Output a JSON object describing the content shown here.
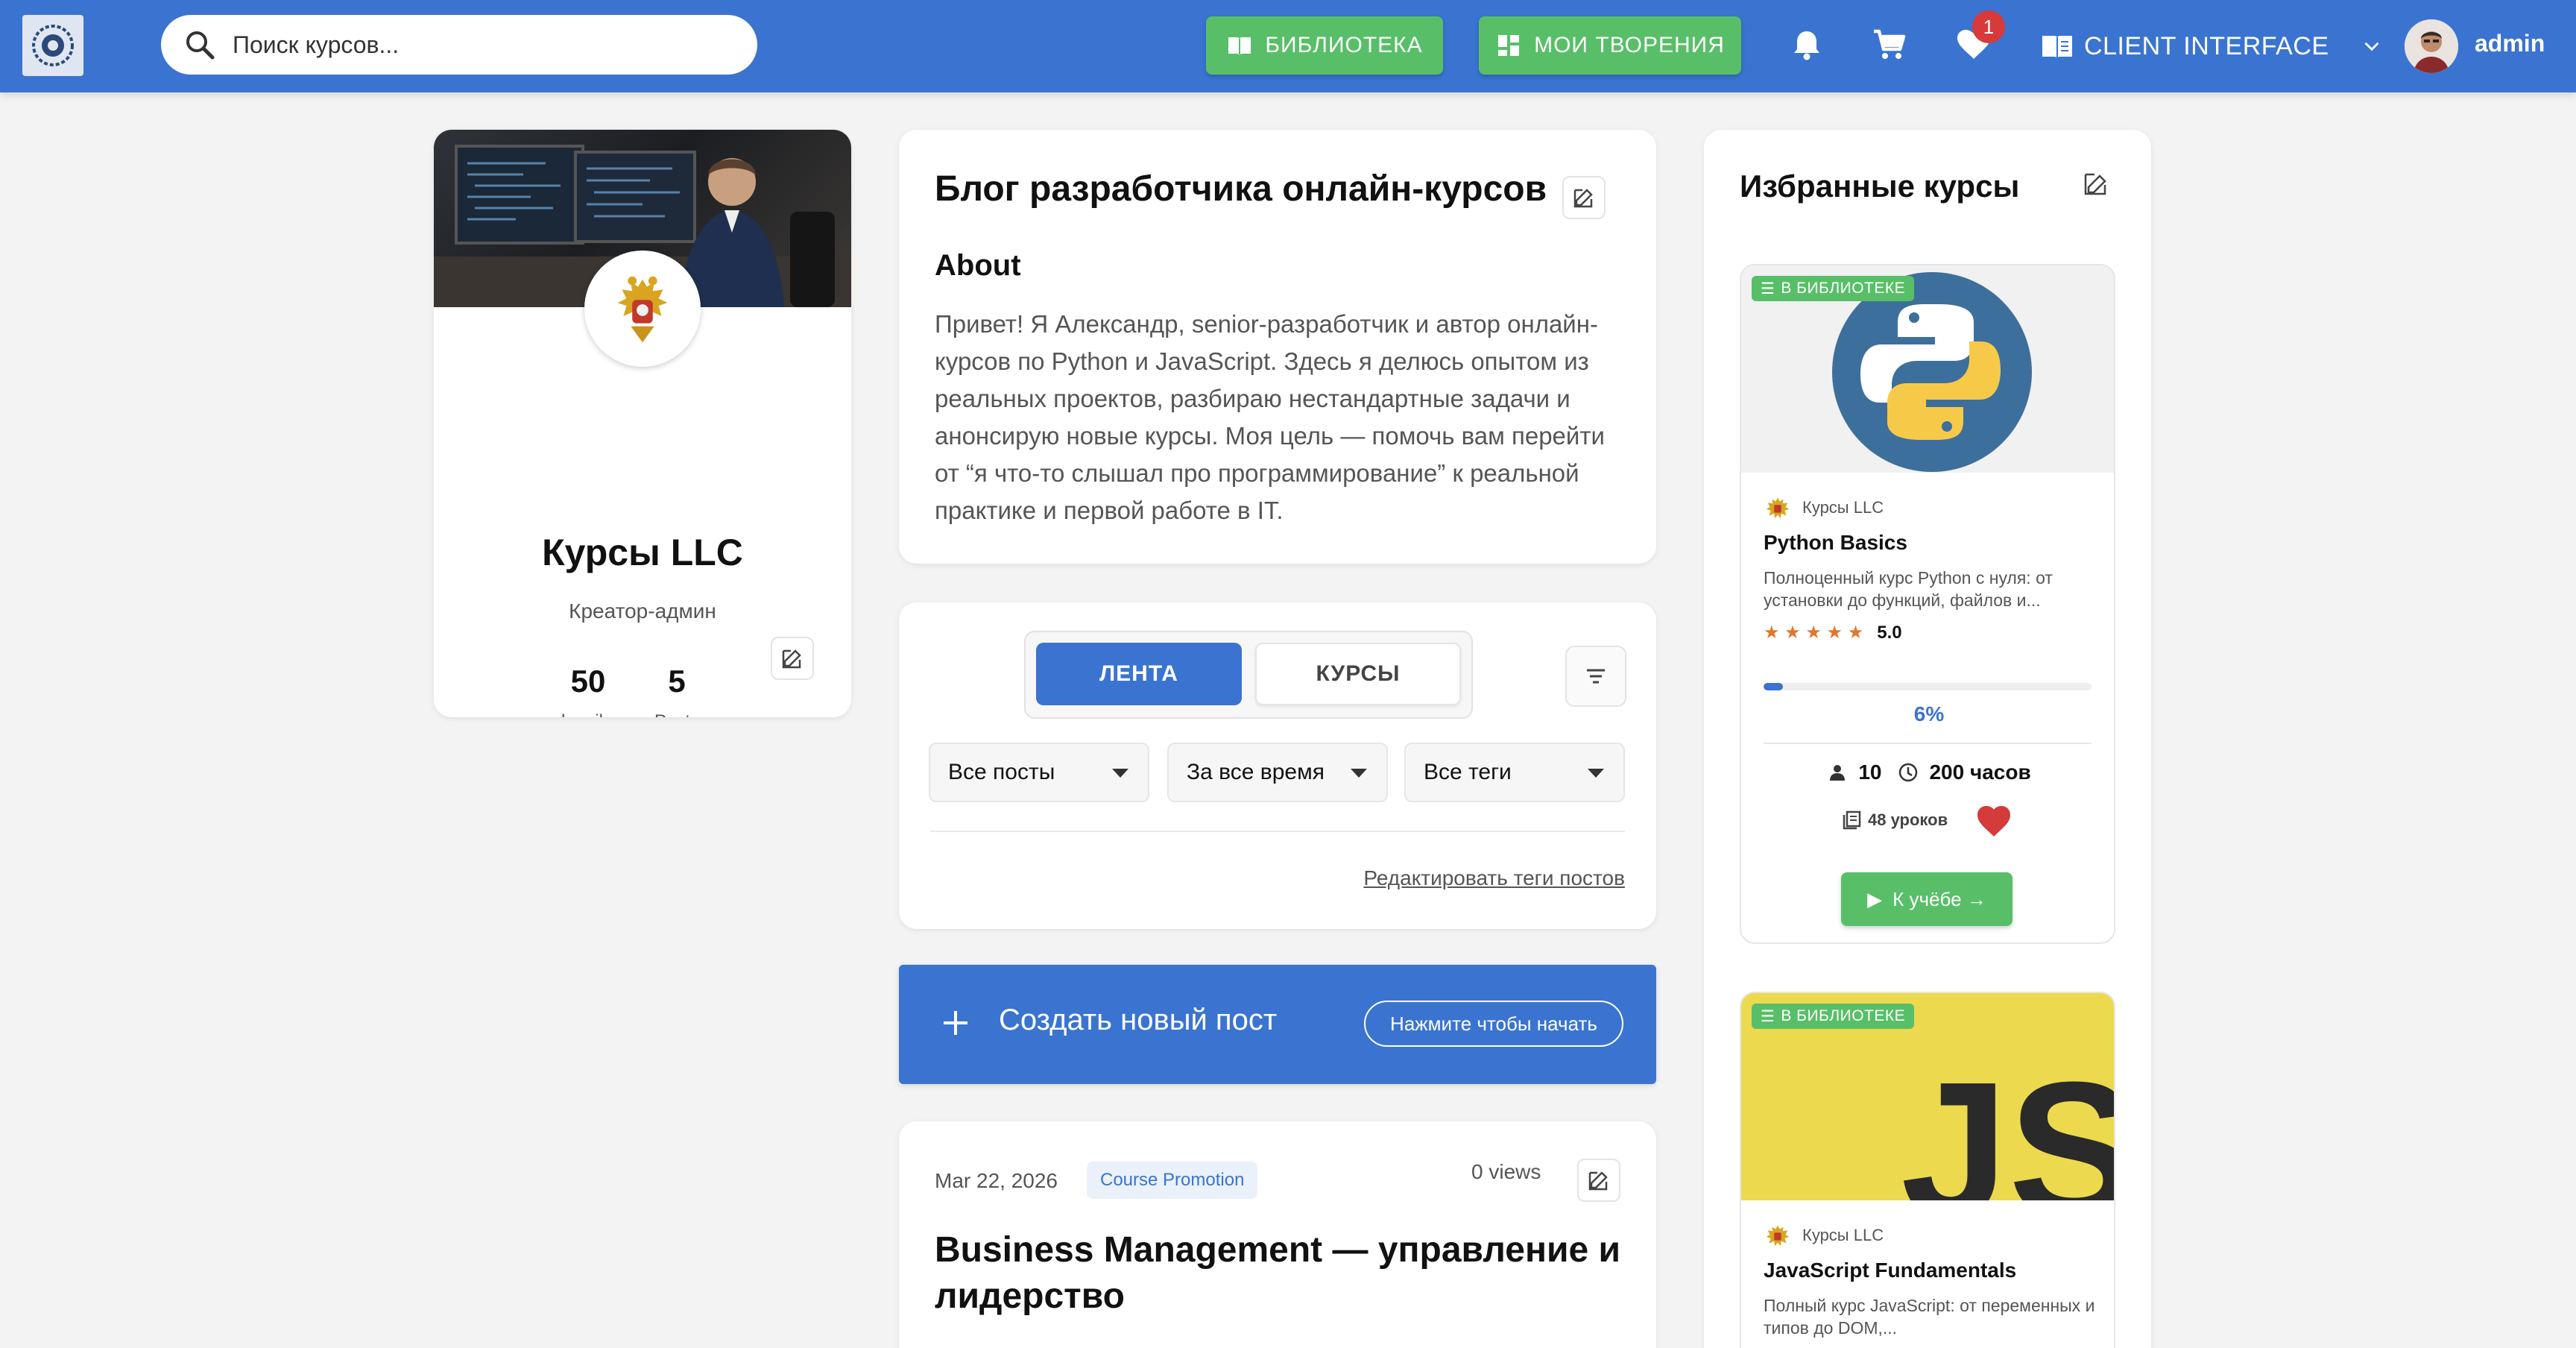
{
  "header": {
    "search_placeholder": "Поиск курсов...",
    "library_label": "БИБЛИОТЕКА",
    "creations_label": "МОИ ТВОРЕНИЯ",
    "favorites_badge": "1",
    "interface_label": "CLIENT INTERFACE",
    "user_name": "admin"
  },
  "profile": {
    "name": "Курсы LLC",
    "role": "Креатор-админ",
    "subscribers_count": "50",
    "subscribers_label": "subscribers",
    "posts_count": "5",
    "posts_label": "Posts"
  },
  "about": {
    "title": "Блог разработчика онлайн-курсов",
    "subtitle": "About",
    "text": "Привет! Я Александр, senior-разработчик и автор онлайн-курсов по Python и JavaScript. Здесь я делюсь опытом из реальных проектов, разбираю нестандартные задачи и анонсирую новые курсы. Моя цель — помочь вам перейти от “я что-то слышал про программирование” к реальной практике и первой работе в IT."
  },
  "filters": {
    "tab_feed": "ЛЕНТА",
    "tab_courses": "КУРСЫ",
    "select_posts": "Все посты",
    "select_time": "За все время",
    "select_tags": "Все теги",
    "edit_tags_link": "Редактировать теги постов"
  },
  "create_post": {
    "label": "Создать новый пост",
    "hint": "Нажмите чтобы начать"
  },
  "post": {
    "date": "Mar 22, 2026",
    "tag": "Course Promotion",
    "views": "0 views",
    "title": "Business Management — управление и лидерство"
  },
  "favorites": {
    "title": "Избранные курсы",
    "courses": [
      {
        "badge": "В БИБЛИОТЕКЕ",
        "author": "Курсы LLC",
        "title": "Python Basics",
        "description": "Полноценный курс Python с нуля: от установки до функций, файлов и...",
        "stars": "★ ★ ★ ★ ★",
        "rating": "5.0",
        "progress": 0.06,
        "progress_label": "6%",
        "students": "10",
        "duration": "200 часов",
        "lessons": "48 уроков",
        "button": "К учёбе →"
      },
      {
        "badge": "В БИБЛИОТЕКЕ",
        "author": "Курсы LLC",
        "title": "JavaScript Fundamentals",
        "description": "Полный курс JavaScript: от переменных и типов до DOM,...",
        "js_logo": "JS"
      }
    ]
  },
  "colors": {
    "brand": "#3a74d0",
    "green": "#58bf68",
    "badge_red": "#d83a3a",
    "star": "#e2762a",
    "js_yellow": "#ecd94e"
  }
}
